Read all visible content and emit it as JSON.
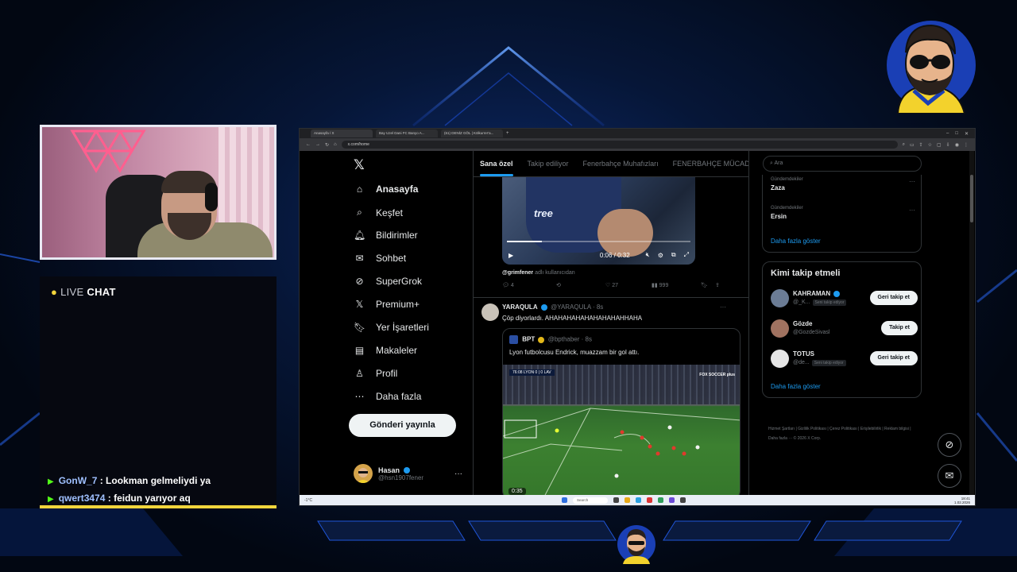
{
  "chat": {
    "title_dot": "●",
    "title_live": "LIVE",
    "title_chat": "CHAT",
    "messages": [
      {
        "user": "GonW_7",
        "text": ": Lookman gelmeliydi ya"
      },
      {
        "user": "qwert3474",
        "text": ": feidun yarıyor aq"
      }
    ]
  },
  "browser": {
    "tabs": [
      "Anasayfa / X",
      "Bay Uzel Dani FC Banyo A...",
      "(61) DENİZ GÖL | Kölkurrer'a..."
    ],
    "url": "x.com/home",
    "window_controls": [
      "–",
      "□",
      "✕"
    ]
  },
  "sidebar": {
    "logo": "𝕏",
    "items": [
      {
        "icon": "⌂",
        "label": "Anasayfa"
      },
      {
        "icon": "⌕",
        "label": "Keşfet"
      },
      {
        "icon": "🔔︎",
        "label": "Bildirimler"
      },
      {
        "icon": "✉",
        "label": "Sohbet"
      },
      {
        "icon": "⊘",
        "label": "SuperGrok"
      },
      {
        "icon": "𝕏",
        "label": "Premium+"
      },
      {
        "icon": "🔖︎",
        "label": "Yer İşaretleri"
      },
      {
        "icon": "▤",
        "label": "Makaleler"
      },
      {
        "icon": "♙",
        "label": "Profil"
      },
      {
        "icon": "⋯",
        "label": "Daha fazla"
      }
    ],
    "post_button": "Gönderi yayınla",
    "account": {
      "name": "Hasan",
      "handle": "@hsn1907fener",
      "more": "···"
    }
  },
  "timeline": {
    "tabs": [
      "Sana özel",
      "Takip ediliyor",
      "Fenerbahçe Muhafızları",
      "FENERBAHÇE MÜCADELE"
    ],
    "video1": {
      "brand": "tree",
      "time": "0:06 / 0:32",
      "progress": 0.19
    },
    "tweet1": {
      "attribution_user": "@grimfener",
      "attribution_text": "adlı kullanıcıdan",
      "replies": "4",
      "reposts": "",
      "likes": "27",
      "views": "999"
    },
    "tweet2": {
      "name": "YARAQULA",
      "handle": "@YARAQULA",
      "time": "· 8s",
      "text": "Çöp diyorlardı. AHAHAHAHAHAHAHAHAHHAHA",
      "more": "···",
      "quote": {
        "name": "BPT",
        "handle": "@bpthaber",
        "time": "· 8s",
        "text": "Lyon futbolcusu Endrick, muazzam bir gol attı.",
        "scoreboard": "76:08 LYON 0 | 0 LAV",
        "broadcaster": "FOX SOCCER plus",
        "duration": "0:35"
      }
    }
  },
  "rightcol": {
    "search_placeholder": "Ara",
    "trends": [
      {
        "category": "Gündemdekiler",
        "name": "Zaza"
      },
      {
        "category": "Gündemdekiler",
        "name": "Ersin"
      }
    ],
    "trends_show_more": "Daha fazla göster",
    "who_title": "Kimi takip etmeli",
    "who": [
      {
        "name": "KAHRAMAN",
        "handle": "@_K...",
        "follows_you": "Seni takip ediyor",
        "button": "Geri takip et",
        "color": "#6b7c95"
      },
      {
        "name": "Gözde",
        "handle": "@GozdeSivasl",
        "follows_you": "",
        "button": "Takip et",
        "color": "#a07260"
      },
      {
        "name": "TOTUS",
        "handle": "@de...",
        "follows_you": "Seni takip ediyor",
        "button": "Geri takip et",
        "color": "#e6e6e6"
      }
    ],
    "who_show_more": "Daha fazla göster",
    "footer": "Hizmet Şartları | Gizlilik Politikası | Çerez Politikası | Erişilebilirlik | Reklam bilgisi | Daha fazla ··· © 2026 X Corp."
  },
  "taskbar": {
    "weather": "-1°C",
    "search": "Search",
    "time": "18:41",
    "date": "1.02.2026"
  }
}
